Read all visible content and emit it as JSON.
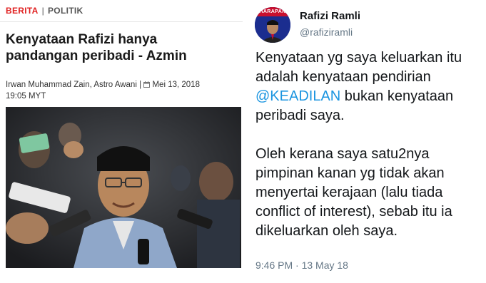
{
  "article": {
    "category_primary": "BERITA",
    "category_separator": "|",
    "category_secondary": "POLITIK",
    "headline": "Kenyataan Rafizi hanya pandangan peribadi - Azmin",
    "byline_authors": "Irwan Muhammad Zain, Astro Awani |",
    "byline_date": "Mei 13, 2018",
    "byline_time": "19:05 MYT"
  },
  "tweet": {
    "avatar_banner": "HARAPAN",
    "author_name": "Rafizi Ramli",
    "author_handle": "@rafiziramli",
    "body_p1_before": "Kenyataan yg saya keluarkan itu adalah kenyataan pendirian ",
    "body_p1_mention": "@KEADILAN",
    "body_p1_after": " bukan kenyataan peribadi saya.",
    "body_p2": "Oleh kerana saya satu2nya pimpinan kanan yg tidak akan menyertai kerajaan (lalu tiada conflict of interest), sebab itu ia dikeluarkan oleh saya.",
    "timestamp": "9:46 PM · 13 May 18",
    "colors": {
      "mention": "#1b95e0",
      "secondary_text": "#657786"
    }
  },
  "colors": {
    "category_accent": "#e02020"
  },
  "icons": [
    "calendar-icon"
  ]
}
